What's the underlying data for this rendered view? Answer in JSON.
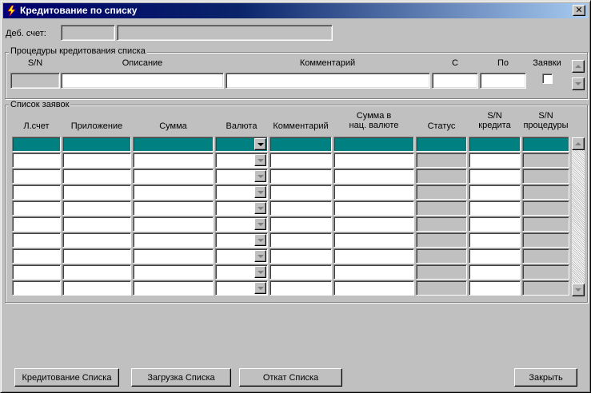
{
  "window": {
    "title": "Кредитование по списку",
    "close_glyph": "✕"
  },
  "debit_account": {
    "label": "Деб. счет:",
    "code_value": "",
    "name_value": ""
  },
  "procedures": {
    "group_title": "Процедуры кредитования списка",
    "headers": {
      "sn": "S/N",
      "description": "Описание",
      "comment": "Комментарий",
      "from": "С",
      "to": "По",
      "requests": "Заявки"
    },
    "row": {
      "sn": "",
      "description": "",
      "comment": "",
      "from": "",
      "to": "",
      "requests_checked": false
    }
  },
  "requests": {
    "group_title": "Список заявок",
    "headers": {
      "account": "Л.счет",
      "application": "Приложение",
      "amount": "Сумма",
      "currency": "Валюта",
      "comment": "Комментарий",
      "amount_national": "Сумма в\nнац. валюте",
      "status": "Статус",
      "credit_sn": "S/N\nкредита",
      "procedure_sn": "S/N\nпроцедуры"
    },
    "row_count": 10
  },
  "buttons": {
    "credit_list": "Кредитование Списка",
    "load_list": "Загрузка Списка",
    "rollback_list": "Откат Списка",
    "close": "Закрыть"
  },
  "colors": {
    "selected_row": "#008080",
    "titlebar_start": "#00006b",
    "titlebar_end": "#a6caf0"
  }
}
